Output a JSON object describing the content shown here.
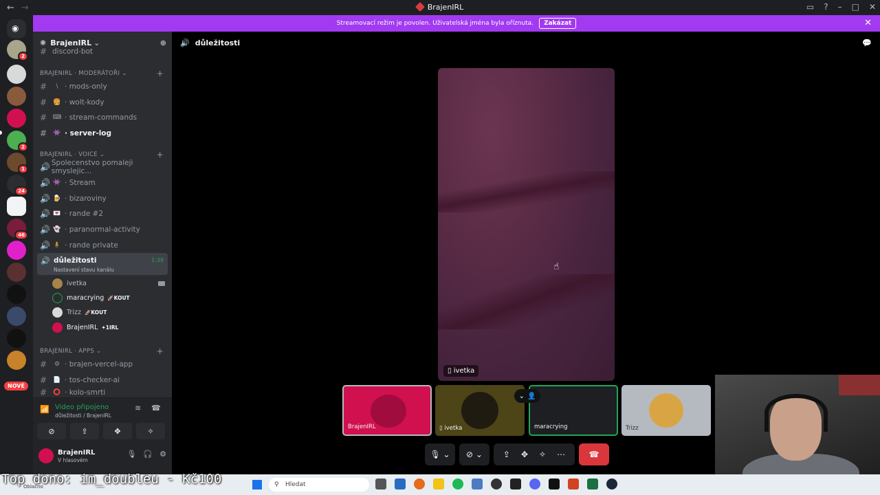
{
  "window": {
    "title": "BrajenIRL"
  },
  "banner": {
    "text": "Streamovací režim je povolen. Uživatelská jména byla oříznuta.",
    "button": "Zakázat"
  },
  "rail": {
    "badges": [
      "2",
      "2",
      "1",
      "24",
      "46"
    ],
    "nove": "NOVÉ"
  },
  "guild": {
    "name": "BrajenIRL"
  },
  "sidebar": {
    "top_cut": "discord-bot",
    "cat_mods": "BRAJENIRL · MODERÁTOŘI",
    "mods_channels": [
      {
        "emoji": "\\",
        "name": "mods-only"
      },
      {
        "emoji": "🍔",
        "name": "wolt-kody"
      },
      {
        "emoji": "⌨",
        "name": "stream-commands"
      },
      {
        "emoji": "👾",
        "name": "server-log"
      }
    ],
    "cat_voice": "BRAJENIRL · VOICE",
    "voice_channels": [
      {
        "emoji": "",
        "name": "Spolecenstvo pomaleji smyslejic..."
      },
      {
        "emoji": "👾",
        "name": "Stream"
      },
      {
        "emoji": "🍺",
        "name": "bizaroviny"
      },
      {
        "emoji": "💌",
        "name": "rande #2"
      },
      {
        "emoji": "👻",
        "name": "paranormal-activity"
      },
      {
        "emoji": "🧍",
        "name": "rande private"
      }
    ],
    "active": {
      "name": "důležitosti",
      "sub": "Nastavení stavu kanálu",
      "time": "1:39"
    },
    "members": [
      {
        "name": "ivetka",
        "tag": ""
      },
      {
        "name": "maracrying",
        "tag": "🚀KOUT"
      },
      {
        "name": "Trizz",
        "tag": "🚀KOUT"
      },
      {
        "name": "BrajenIRL",
        "tag": "✦1IRL"
      }
    ],
    "cat_apps": "BRAJENIRL · APPS",
    "apps_channels": [
      {
        "emoji": "⚙",
        "name": "brajen-vercel-app"
      },
      {
        "emoji": "📄",
        "name": "tos-checker-ai"
      },
      {
        "emoji": "⭕",
        "name": "kolo-smrti"
      }
    ]
  },
  "voice_panel": {
    "status": "Video připojeno",
    "channel": "důležitosti / BrajenIRL"
  },
  "user_panel": {
    "name": "BrajenIRL",
    "status": "V hlasovém"
  },
  "main": {
    "channel": "důležitosti"
  },
  "video": {
    "main_label": "ivetka"
  },
  "tiles": [
    {
      "label": "BrajenIRL"
    },
    {
      "label": "ivetka"
    },
    {
      "label": "maracrying"
    },
    {
      "label": "Trizz"
    }
  ],
  "taskbar": {
    "search_placeholder": "Hledat",
    "weather": "Oblačno"
  },
  "overlay": {
    "text": "Top dono: im_doubleu - Kč100"
  },
  "colors": {
    "accent": "#a13af0",
    "green": "#23a559",
    "red": "#da373c",
    "brand": "#d1104f"
  }
}
